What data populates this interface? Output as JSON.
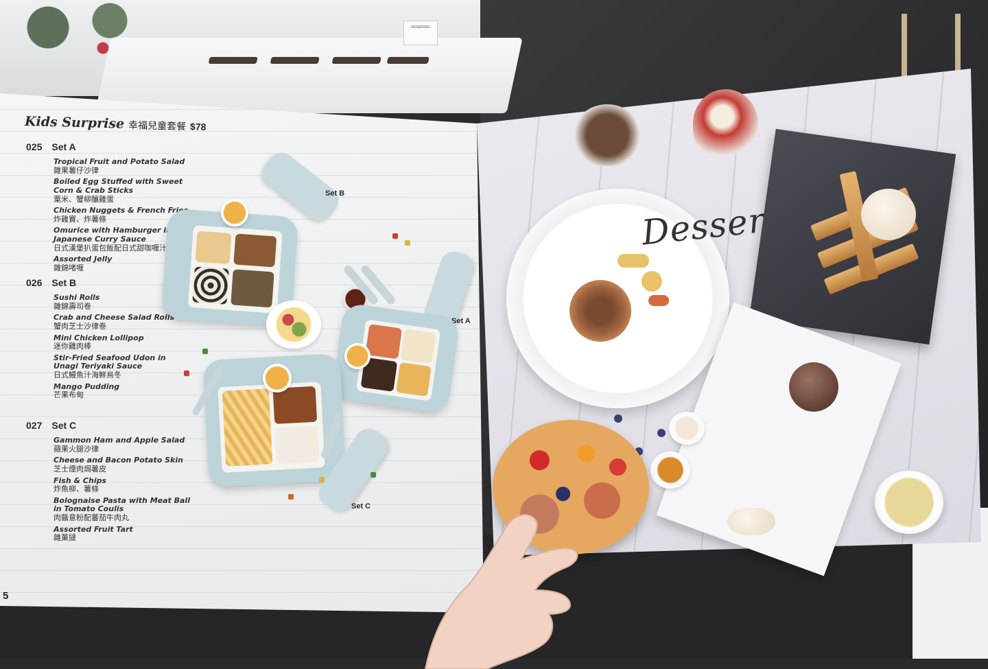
{
  "menu": {
    "heading_script": "Kids Surprise",
    "heading_zh": "幸福兒童套餐",
    "heading_price": "$78",
    "page_number": "5",
    "sets": [
      {
        "code": "025",
        "name": "Set A",
        "items": [
          {
            "en": "Tropical Fruit and Potato Salad",
            "zh": "雜果薯仔沙律"
          },
          {
            "en": "Boiled Egg Stuffed with Sweet Corn & Crab Sticks",
            "zh": "粟米、蟹柳釀雞蛋"
          },
          {
            "en": "Chicken Nuggets & French Fries",
            "zh": "炸雞寶、炸薯條"
          },
          {
            "en": "Omurice with Hamburger in Japanese Curry Sauce",
            "zh": "日式漢堡扒蛋包飯配日式甜咖喱汁"
          },
          {
            "en": "Assorted Jelly",
            "zh": "雜錦啫喱"
          }
        ]
      },
      {
        "code": "026",
        "name": "Set B",
        "items": [
          {
            "en": "Sushi Rolls",
            "zh": "雜錦壽司卷"
          },
          {
            "en": "Crab and Cheese Salad Rolls",
            "zh": "蟹肉芝士沙律卷"
          },
          {
            "en": "Mini Chicken Lollipop",
            "zh": "迷你雞肉棒"
          },
          {
            "en": "Stir-Fried Seafood Udon in Unagi Teriyaki Sauce",
            "zh": "日式鰻魚汁海鮮烏冬"
          },
          {
            "en": "Mango Pudding",
            "zh": "芒果布甸"
          }
        ]
      },
      {
        "code": "027",
        "name": "Set C",
        "items": [
          {
            "en": "Gammon Ham and Apple Salad",
            "zh": "蘋果火腿沙律"
          },
          {
            "en": "Cheese and Bacon Potato Skin",
            "zh": "芝士煙肉焗薯皮"
          },
          {
            "en": "Fish & Chips",
            "zh": "炸魚柳、薯條"
          },
          {
            "en": "Bolognaise Pasta with Meat Ball in Tomato Coulis",
            "zh": "肉醬意粉配蕃茄牛肉丸"
          },
          {
            "en": "Assorted Fruit Tart",
            "zh": "雜菓撻"
          }
        ]
      }
    ],
    "photo_labels": {
      "set_a": "Set A",
      "set_b": "Set B",
      "set_c": "Set C"
    }
  },
  "dessert": {
    "title": "Dessert"
  },
  "background": {
    "sign_text": "RESERVED"
  },
  "colors": {
    "lunchbox": "#bcd3d9",
    "page": "#eef0f1",
    "text": "#2b2b2b"
  }
}
